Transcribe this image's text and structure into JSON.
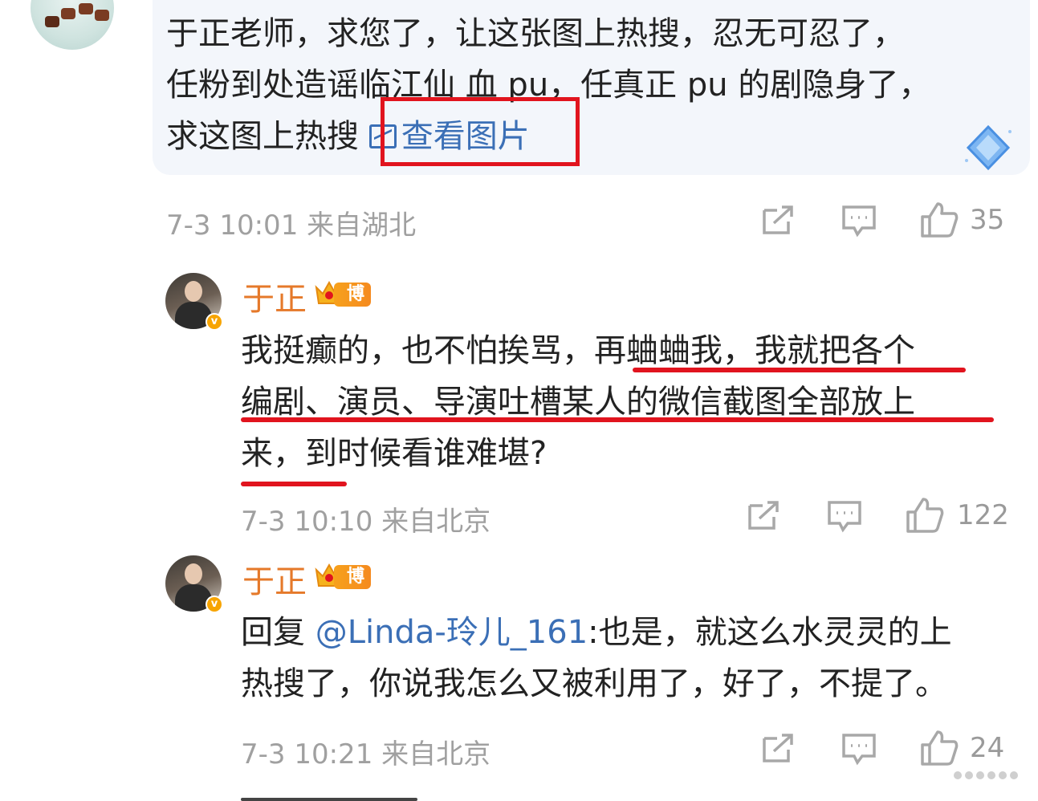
{
  "top_comment": {
    "line1": "于正老师，求您了，让这张图上热搜，忍无可忍了，",
    "line2": "任粉到处造谣临江仙 血 pu，任真正 pu 的剧隐身了，",
    "line3": "求这图上热搜 ",
    "link_label": "查看图片",
    "link_icon": "image-icon",
    "time": "7-3 10:01",
    "location": "来自湖北",
    "likes": "35"
  },
  "replies": [
    {
      "user": "于正",
      "badge": "博主",
      "verified_mark": "v",
      "line1_plain": "我挺癫的，也不怕挨骂，",
      "line1_underlined": "再蛐蛐我，我就把各个",
      "line2": "编剧、演员、导演吐槽某人的微信截图全部放上",
      "line3_underlined": "来，",
      "line3_rest": "到时候看谁难堪?",
      "time": "7-3 10:10",
      "location": "来自北京",
      "likes": "122"
    },
    {
      "user": "于正",
      "badge": "博主",
      "verified_mark": "v",
      "reply_prefix": "回复 ",
      "mention": "@Linda-玲儿_161",
      "line1_rest": ":也是，就这么水灵灵的上",
      "line2": "热搜了，你说我怎么又被利用了，好了，不提了。",
      "time": "7-3 10:21",
      "location": "来自北京",
      "likes": "24"
    }
  ],
  "colors": {
    "link": "#3b6fb6",
    "username": "#e5792a",
    "highlight": "#e1141e",
    "meta": "#a0a0a0"
  }
}
